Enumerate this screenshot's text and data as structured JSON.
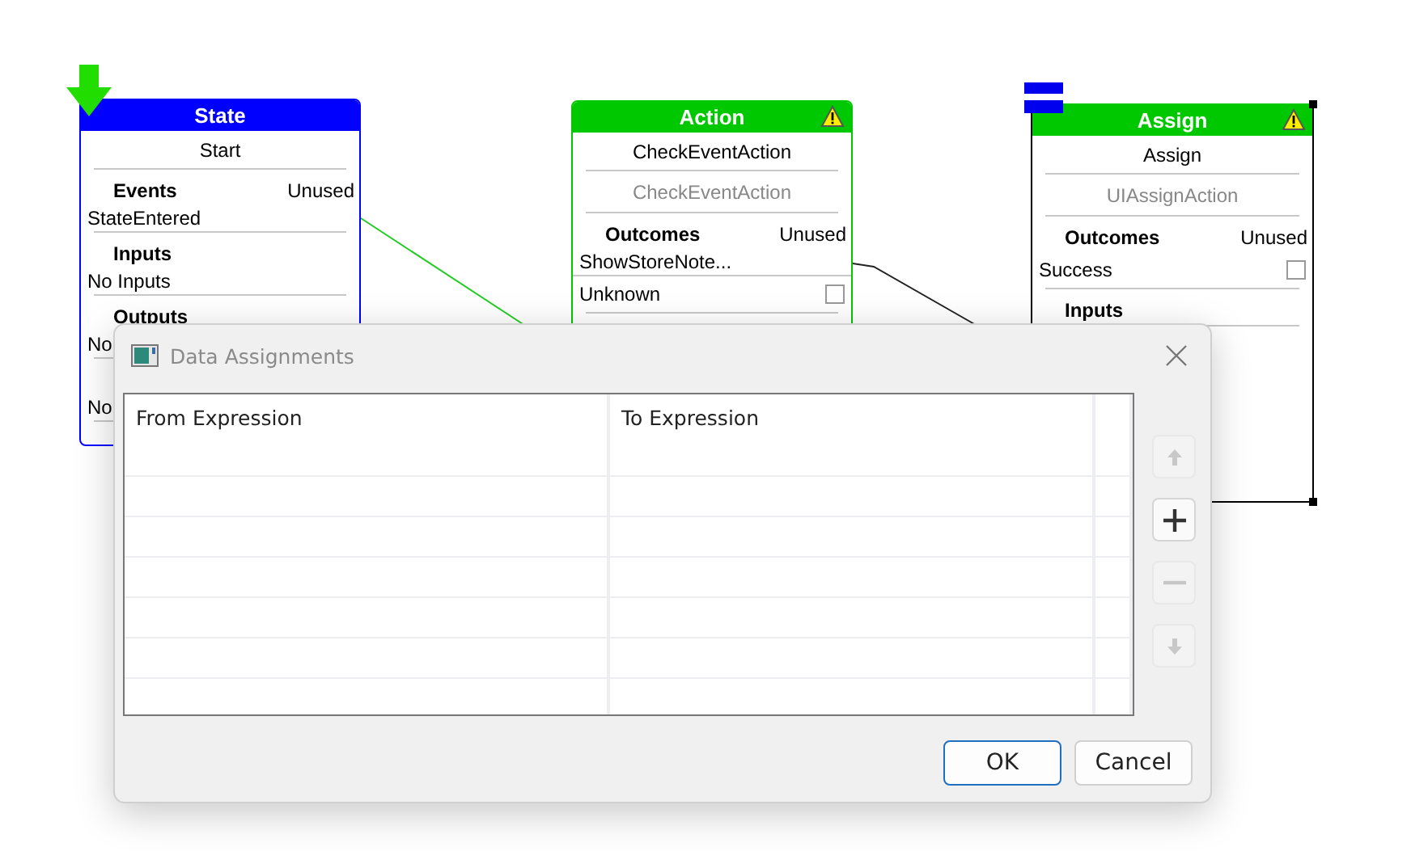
{
  "nodes": [
    {
      "title": "State",
      "color": "#0000ff",
      "warning": false,
      "selected": false,
      "name": "Start",
      "sections": [
        {
          "heading": "Events",
          "status": "Unused",
          "items": [
            {
              "label": "StateEntered"
            }
          ]
        },
        {
          "heading": "Inputs",
          "items": [
            {
              "label": "No Inputs"
            }
          ]
        },
        {
          "heading": "Outputs",
          "items": [
            {
              "label": "No"
            }
          ]
        },
        {
          "items": [
            {
              "label": "No"
            }
          ]
        }
      ]
    },
    {
      "title": "Action",
      "color": "#00c800",
      "warning": true,
      "selected": false,
      "name": "CheckEventAction",
      "subtitle": "CheckEventAction",
      "sections": [
        {
          "heading": "Outcomes",
          "status": "Unused",
          "items": [
            {
              "label": "ShowStoreNote..."
            },
            {
              "label": "Unknown",
              "checked": false
            }
          ]
        }
      ]
    },
    {
      "title": "Assign",
      "color": "#00c800",
      "warning": true,
      "selected": true,
      "name": "Assign",
      "subtitle": "UIAssignAction",
      "sections": [
        {
          "heading": "Outcomes",
          "status": "Unused",
          "items": [
            {
              "label": "Success",
              "checked": false
            }
          ]
        },
        {
          "heading": "Inputs"
        }
      ]
    }
  ],
  "dialog": {
    "title": "Data Assignments",
    "table": {
      "columns": [
        "From Expression",
        "To Expression"
      ]
    },
    "side_buttons": [
      {
        "kind": "up",
        "disabled": true
      },
      {
        "kind": "add",
        "disabled": false
      },
      {
        "kind": "remove",
        "disabled": true
      },
      {
        "kind": "down",
        "disabled": true
      }
    ],
    "buttons": [
      {
        "label": "OK",
        "default": true
      },
      {
        "label": "Cancel",
        "default": false
      }
    ]
  }
}
